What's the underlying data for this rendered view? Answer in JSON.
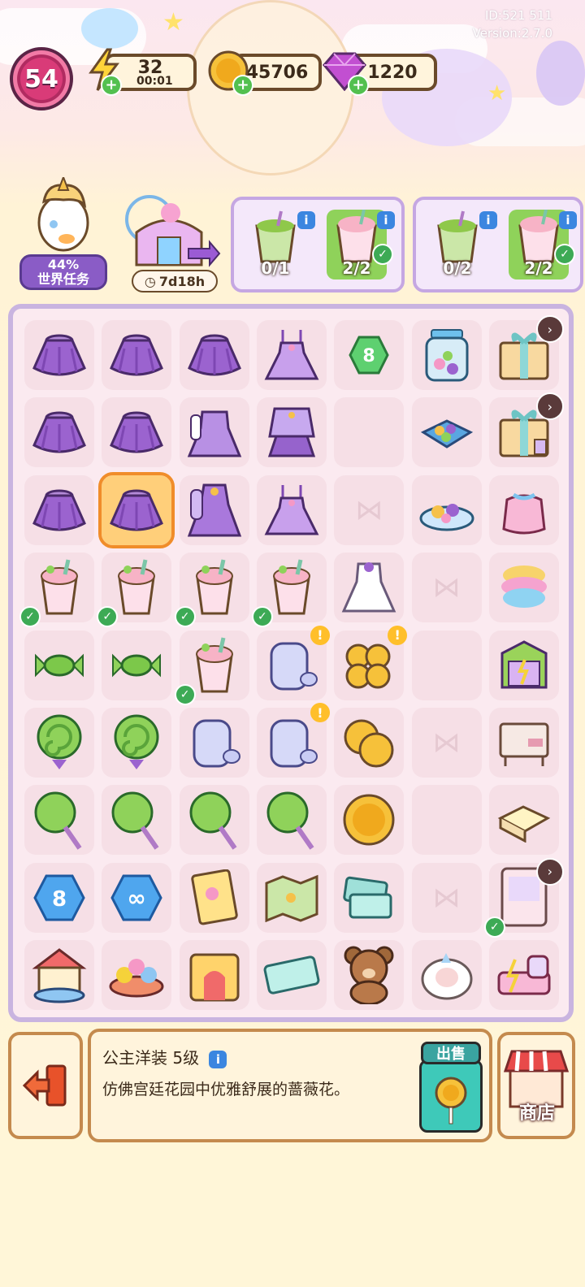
{
  "meta": {
    "id": "ID:521 511",
    "version": "Version:2.7.0"
  },
  "hud": {
    "level": "54",
    "energy": "32",
    "energy_timer": "00:01",
    "coins": "45706",
    "gems": "1220"
  },
  "world_task": {
    "progress": "44%",
    "label": "世界任务"
  },
  "event": {
    "timer": "7d18h"
  },
  "orders": [
    {
      "slots": [
        {
          "count": "0/1",
          "done": false
        },
        {
          "count": "2/2",
          "done": true
        }
      ]
    },
    {
      "slots": [
        {
          "count": "0/2",
          "done": false
        },
        {
          "count": "2/2",
          "done": true
        }
      ]
    }
  ],
  "board_items": [
    "purple-skirt",
    "purple-skirt",
    "purple-skirt",
    "lavender-dress",
    "green-hexagon-8",
    "candy-jar",
    "gift-box",
    "purple-skirt",
    "purple-skirt",
    "lavender-coat-dress",
    "lavender-jacket-skirt",
    "empty",
    "candy-tray",
    "gift-box-tag",
    "purple-skirt",
    "purple-skirt",
    "princess-gown",
    "lavender-dress",
    "locked",
    "candy-plate",
    "candy-bag",
    "pink-drink",
    "pink-drink",
    "pink-drink",
    "pink-drink",
    "white-dress",
    "locked",
    "cotton-candy",
    "green-candy",
    "green-candy",
    "pink-drink",
    "glass-jar",
    "gold-coin-pile",
    "empty",
    "shop-building",
    "green-lollipop",
    "green-lollipop",
    "glass-jar",
    "glass-jar",
    "gold-coin-pair",
    "locked",
    "cabinet",
    "green-round-lollipop",
    "green-round-lollipop",
    "green-round-lollipop",
    "green-round-lollipop",
    "gold-coin",
    "empty",
    "butter-block",
    "blue-hexagon-8",
    "blue-hexagon-infinity",
    "storybook",
    "park-map",
    "tickets",
    "locked",
    "vanity-cabinet",
    "carousel",
    "teacup-ride",
    "castle-gate",
    "ticket",
    "teddy-bear",
    "sheep-plush",
    "pink-bed"
  ],
  "selected_item": {
    "name": "公主洋装 5级",
    "description": "仿佛宫廷花园中优雅舒展的蔷薇花。",
    "sell_label": "出售"
  },
  "shop_label": "商店",
  "colors": {
    "accent": "#c9b4e0",
    "wood": "#c48a4e",
    "sell": "#3ec9b9"
  }
}
